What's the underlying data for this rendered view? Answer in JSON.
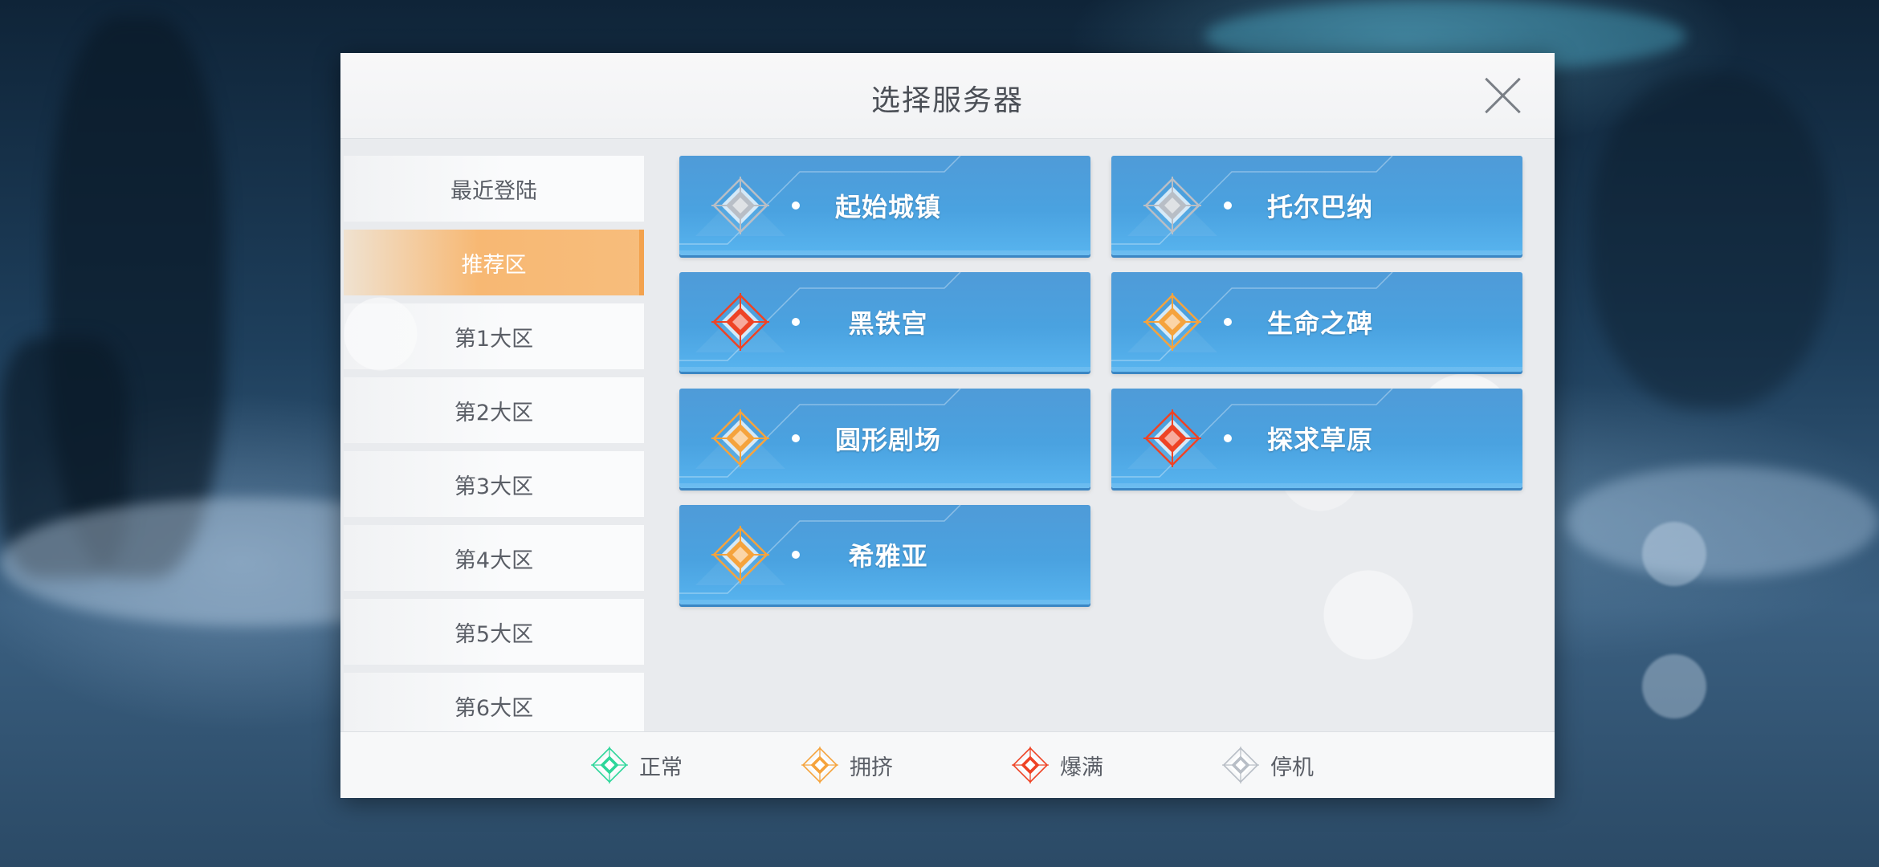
{
  "dialog": {
    "title": "选择服务器"
  },
  "sidebar": {
    "items": [
      {
        "label": "最近登陆",
        "active": false
      },
      {
        "label": "推荐区",
        "active": true
      },
      {
        "label": "第1大区",
        "active": false
      },
      {
        "label": "第2大区",
        "active": false
      },
      {
        "label": "第3大区",
        "active": false
      },
      {
        "label": "第4大区",
        "active": false
      },
      {
        "label": "第5大区",
        "active": false
      },
      {
        "label": "第6大区",
        "active": false
      }
    ]
  },
  "servers": [
    {
      "name": "起始城镇",
      "status": "offline"
    },
    {
      "name": "托尔巴纳",
      "status": "offline"
    },
    {
      "name": "黑铁宫",
      "status": "full"
    },
    {
      "name": "生命之碑",
      "status": "crowded"
    },
    {
      "name": "圆形剧场",
      "status": "crowded"
    },
    {
      "name": "探求草原",
      "status": "full"
    },
    {
      "name": "希雅亚",
      "status": "crowded"
    }
  ],
  "legend": [
    {
      "label": "正常",
      "status": "normal"
    },
    {
      "label": "拥挤",
      "status": "crowded"
    },
    {
      "label": "爆满",
      "status": "full"
    },
    {
      "label": "停机",
      "status": "offline"
    }
  ],
  "status_colors": {
    "normal": "#2ed69a",
    "crowded": "#f5a33d",
    "full": "#ee4325",
    "offline": "#b8bec6"
  },
  "icons": {
    "close": "close-icon",
    "status": "diamond-compass-icon"
  }
}
